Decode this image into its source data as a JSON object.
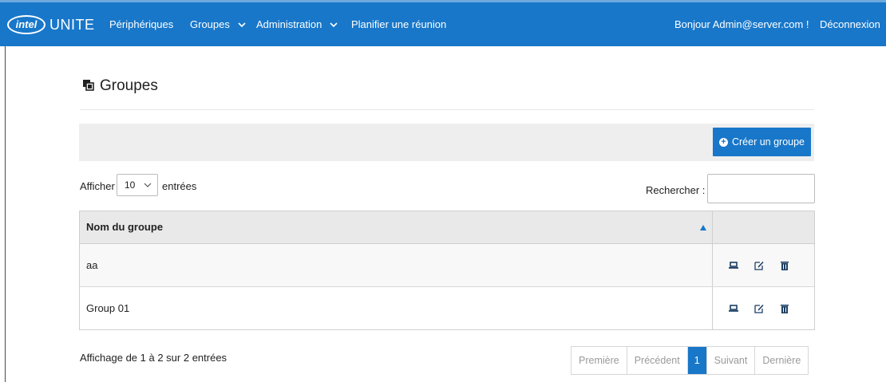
{
  "app": {
    "logo_brand": "intel",
    "logo_product": "UNITE"
  },
  "nav": {
    "items": [
      {
        "label": "Périphériques",
        "has_dropdown": false
      },
      {
        "label": "Groupes",
        "has_dropdown": true
      },
      {
        "label": "Administration",
        "has_dropdown": true
      },
      {
        "label": "Planifier une réunion",
        "has_dropdown": false
      }
    ],
    "greeting": "Bonjour Admin@server.com !",
    "logout": "Déconnexion"
  },
  "page": {
    "title": "Groupes",
    "create_button": "Créer un groupe"
  },
  "table_controls": {
    "show_label": "Afficher",
    "length_value": "10",
    "entries_label": "entrées",
    "search_label": "Rechercher :",
    "search_value": ""
  },
  "table": {
    "column_name": "Nom du groupe",
    "rows": [
      {
        "name": "aa"
      },
      {
        "name": "Group 01"
      }
    ]
  },
  "footer": {
    "info": "Affichage de 1 à 2 sur 2 entrées",
    "pagination": {
      "first": "Première",
      "previous": "Précédent",
      "current": "1",
      "next": "Suivant",
      "last": "Dernière"
    }
  },
  "colors": {
    "brand_blue": "#1877c9",
    "toolbar_gray": "#eeeeef"
  },
  "icons": {
    "row_actions": [
      "laptop-icon",
      "edit-icon",
      "trash-icon"
    ]
  }
}
